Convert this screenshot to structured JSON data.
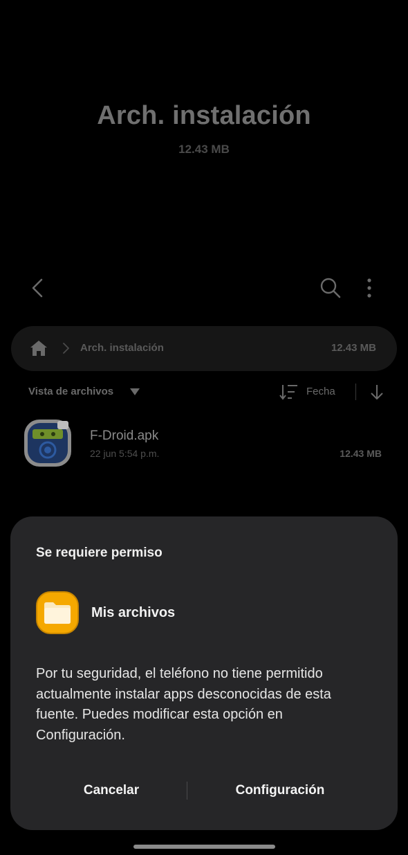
{
  "header": {
    "title": "Arch. instalación",
    "size": "12.43 MB"
  },
  "toolbar": {
    "back_icon": "chevron-left-icon",
    "search_icon": "search-icon",
    "more_icon": "more-vertical-icon"
  },
  "pathbar": {
    "home_icon": "home-icon",
    "folder": "Arch. instalación",
    "size": "12.43 MB"
  },
  "listbar": {
    "view_label": "Vista de archivos",
    "sort_label": "Fecha"
  },
  "files": [
    {
      "name": "F-Droid.apk",
      "date": "22 jun 5:54 p.m.",
      "size": "12.43 MB"
    }
  ],
  "dialog": {
    "title": "Se requiere permiso",
    "app_name": "Mis archivos",
    "message": "Por tu seguridad, el teléfono no tiene permitido actualmente instalar apps desconocidas de esta fuente. Puedes modificar esta opción en Configuración.",
    "cancel_label": "Cancelar",
    "settings_label": "Configuración"
  },
  "colors": {
    "background": "#000000",
    "dialog_bg": "#262628",
    "folder_icon": "#f5a800"
  }
}
